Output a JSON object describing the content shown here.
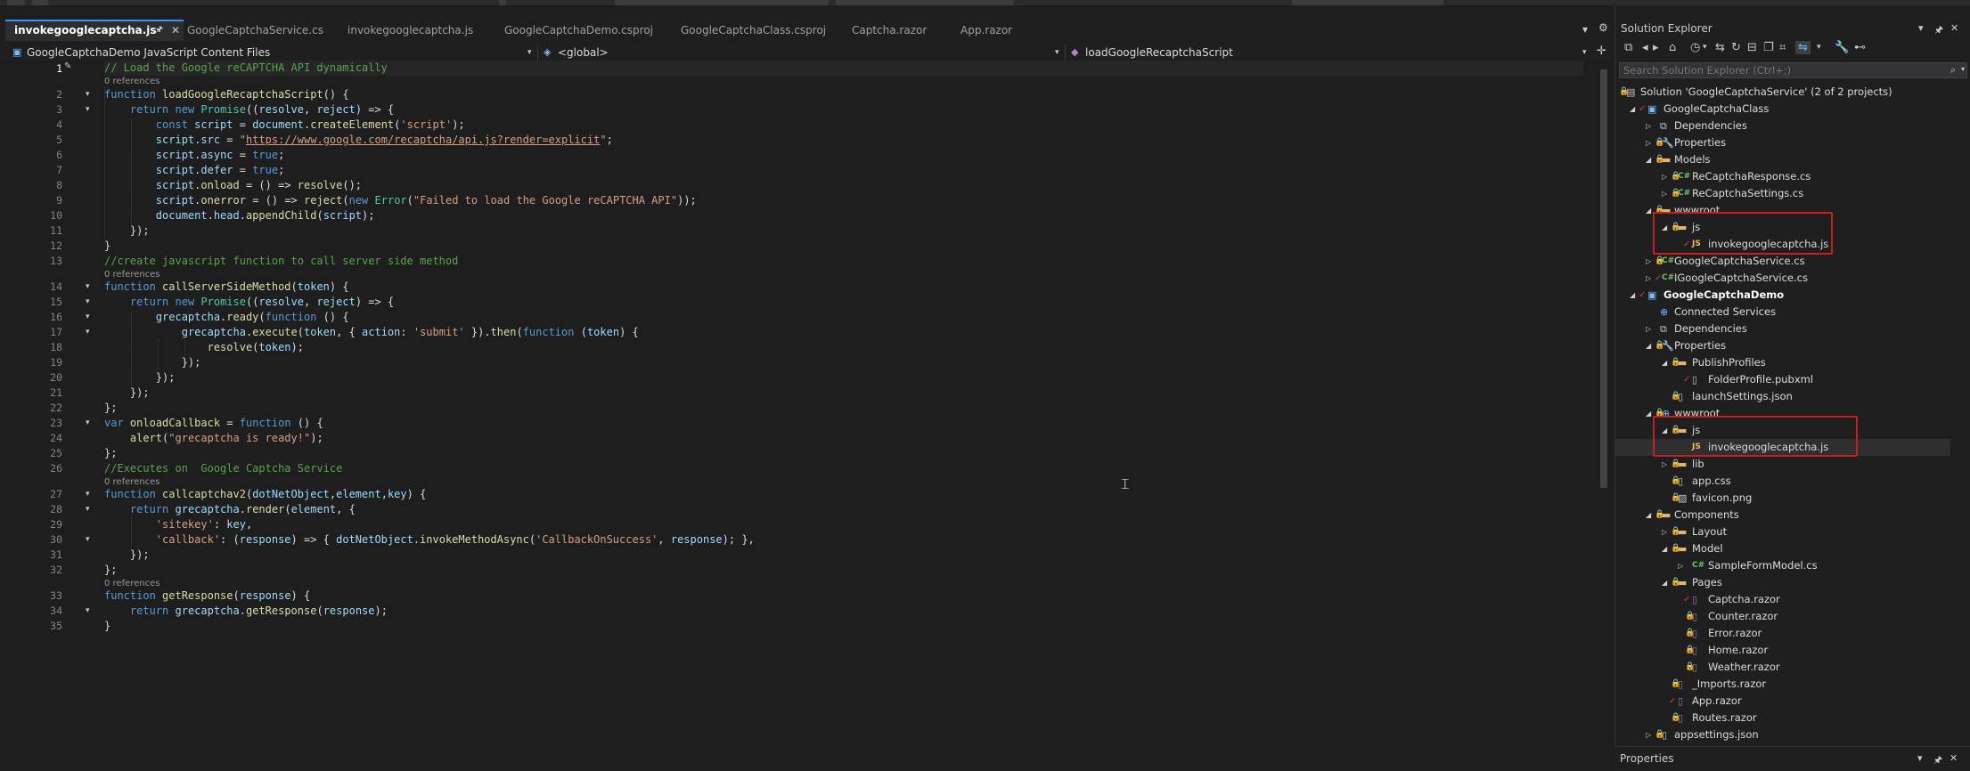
{
  "tabs": [
    {
      "label": "invokegooglecaptcha.js",
      "active": true
    },
    {
      "label": "GoogleCaptchaService.cs"
    },
    {
      "label": "invokegooglecaptcha.js"
    },
    {
      "label": "GoogleCaptchaDemo.csproj"
    },
    {
      "label": "GoogleCaptchaClass.csproj"
    },
    {
      "label": "Captcha.razor"
    },
    {
      "label": "App.razor"
    }
  ],
  "navbar": {
    "project": "GoogleCaptchaDemo JavaScript Content Files",
    "scope": "<global>",
    "member": "loadGoogleRecaptchaScript"
  },
  "editor": {
    "refs_label": "0 references",
    "current_line": "1"
  },
  "solution_explorer": {
    "title": "Solution Explorer",
    "search_placeholder": "Search Solution Explorer (Ctrl+;)",
    "items": [
      {
        "label": "Solution 'GoogleCaptchaService' (2 of 2 projects)",
        "icon": "solution-icon"
      },
      {
        "label": "GoogleCaptchaClass",
        "icon": "project-icon"
      },
      {
        "label": "Dependencies",
        "icon": "dependencies-icon"
      },
      {
        "label": "Properties",
        "icon": "properties-icon"
      },
      {
        "label": "Models",
        "icon": "folder-icon"
      },
      {
        "label": "ReCaptchaResponse.cs",
        "icon": "csharp-file-icon"
      },
      {
        "label": "ReCaptchaSettings.cs",
        "icon": "csharp-file-icon"
      },
      {
        "label": "wwwroot",
        "icon": "folder-icon"
      },
      {
        "label": "js",
        "icon": "folder-icon"
      },
      {
        "label": "invokegooglecaptcha.js",
        "icon": "js-file-icon"
      },
      {
        "label": "GoogleCaptchaService.cs",
        "icon": "csharp-file-icon"
      },
      {
        "label": "IGoogleCaptchaService.cs",
        "icon": "csharp-file-icon"
      },
      {
        "label": "GoogleCaptchaDemo",
        "icon": "web-project-icon"
      },
      {
        "label": "Connected Services",
        "icon": "connected-services-icon"
      },
      {
        "label": "Dependencies",
        "icon": "dependencies-icon"
      },
      {
        "label": "Properties",
        "icon": "properties-icon"
      },
      {
        "label": "PublishProfiles",
        "icon": "folder-icon"
      },
      {
        "label": "FolderProfile.pubxml",
        "icon": "file-icon"
      },
      {
        "label": "launchSettings.json",
        "icon": "json-file-icon"
      },
      {
        "label": "wwwroot",
        "icon": "globe-icon"
      },
      {
        "label": "js",
        "icon": "folder-icon"
      },
      {
        "label": "invokegooglecaptcha.js",
        "icon": "js-file-icon"
      },
      {
        "label": "lib",
        "icon": "folder-icon"
      },
      {
        "label": "app.css",
        "icon": "css-file-icon"
      },
      {
        "label": "favicon.png",
        "icon": "image-file-icon"
      },
      {
        "label": "Components",
        "icon": "folder-icon"
      },
      {
        "label": "Layout",
        "icon": "folder-icon"
      },
      {
        "label": "Model",
        "icon": "folder-icon"
      },
      {
        "label": "SampleFormModel.cs",
        "icon": "csharp-file-icon"
      },
      {
        "label": "Pages",
        "icon": "folder-icon"
      },
      {
        "label": "Captcha.razor",
        "icon": "razor-file-icon"
      },
      {
        "label": "Counter.razor",
        "icon": "razor-file-icon"
      },
      {
        "label": "Error.razor",
        "icon": "razor-file-icon"
      },
      {
        "label": "Home.razor",
        "icon": "razor-file-icon"
      },
      {
        "label": "Weather.razor",
        "icon": "razor-file-icon"
      },
      {
        "label": "_Imports.razor",
        "icon": "razor-file-icon"
      },
      {
        "label": "App.razor",
        "icon": "razor-file-icon"
      },
      {
        "label": "Routes.razor",
        "icon": "razor-file-icon"
      },
      {
        "label": "appsettings.json",
        "icon": "json-file-icon"
      }
    ]
  },
  "properties": {
    "title": "Properties"
  },
  "colors": {
    "accent": "#3794ff",
    "highlight_box": "#c81e1e",
    "keyword": "#569cd6",
    "string": "#d69d85",
    "comment": "#57a64a"
  }
}
